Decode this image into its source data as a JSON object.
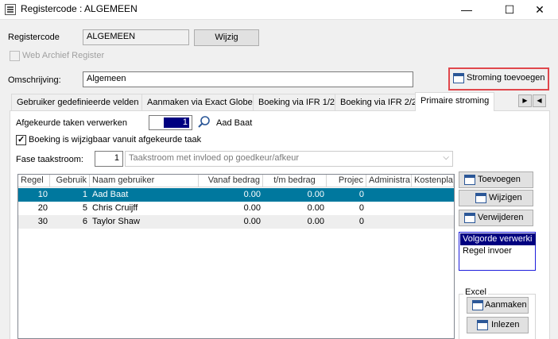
{
  "window": {
    "title": "Registercode : ALGEMEEN",
    "minimize": "—",
    "maximize": "☐",
    "close": "✕"
  },
  "registercode": {
    "label": "Registercode",
    "value": "ALGEMEEN",
    "button": "Wijzig"
  },
  "web_archief": {
    "label": "Web Archief Register",
    "checked": false
  },
  "omschrijving": {
    "label": "Omschrijving:",
    "value": "Algemeen"
  },
  "stroming_button": "Stroming toevoegen",
  "tabs": [
    {
      "label": "Gebruiker gedefinieerde velden",
      "active": false
    },
    {
      "label": "Aanmaken via Exact Globe",
      "active": false
    },
    {
      "label": "Boeking via IFR 1/2",
      "active": false
    },
    {
      "label": "Boeking via IFR 2/2",
      "active": false
    },
    {
      "label": "Primaire stroming",
      "active": true
    }
  ],
  "afgekeurde": {
    "label": "Afgekeurde taken verwerken",
    "value": "1",
    "user": "Aad Baat"
  },
  "wijzigbaar": {
    "label": "Boeking is wijzigbaar vanuit afgekeurde taak",
    "checked": true
  },
  "fase": {
    "label": "Fase taakstroom:",
    "value": "1",
    "dropdown": "Taakstroom met invloed op goedkeur/afkeur"
  },
  "grid": {
    "columns": [
      "Regel",
      "Gebruik",
      "Naam gebruiker",
      "Vanaf bedrag",
      "t/m bedrag",
      "Projec",
      "Administra",
      "Kostenpla"
    ],
    "rows": [
      {
        "regel": "10",
        "gebruiker": "1",
        "naam": "Aad Baat",
        "vanaf": "0.00",
        "tm": "0.00",
        "project": "0",
        "selected": true
      },
      {
        "regel": "20",
        "gebruiker": "5",
        "naam": "Chris Cruijff",
        "vanaf": "0.00",
        "tm": "0.00",
        "project": "0",
        "selected": false
      },
      {
        "regel": "30",
        "gebruiker": "6",
        "naam": "Taylor Shaw",
        "vanaf": "0.00",
        "tm": "0.00",
        "project": "0",
        "selected": false
      }
    ]
  },
  "side_buttons": {
    "toevoegen": "Toevoegen",
    "wijzigen": "Wijzigen",
    "verwijderen": "Verwijderen"
  },
  "sort_list": [
    "Volgorde verwerki",
    "Regel invoer"
  ],
  "excel": {
    "group_label": "Excel",
    "aanmaken": "Aanmaken",
    "inlezen": "Inlezen"
  },
  "colors": {
    "selected_row": "#00789e",
    "highlight_border": "#e0474c",
    "list_selection": "#000080"
  }
}
